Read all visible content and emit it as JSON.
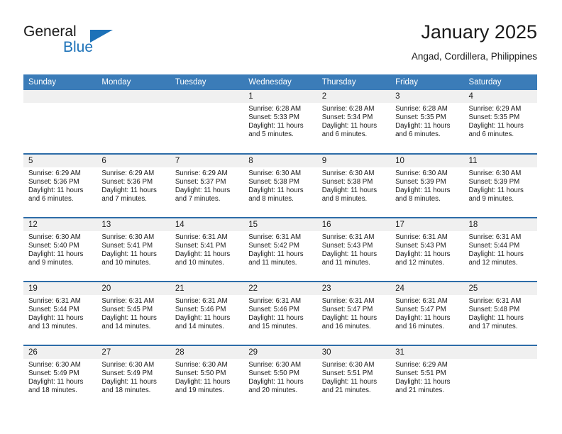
{
  "brand": {
    "name_part1": "General",
    "name_part2": "Blue",
    "triangle_color": "#1d72b8"
  },
  "header": {
    "title": "January 2025",
    "subtitle": "Angad, Cordillera, Philippines",
    "header_bg_color": "#3b7cb8",
    "separator_color": "#2d6ca8",
    "daynum_band_color": "#f0f0f0"
  },
  "weekday_headers": [
    "Sunday",
    "Monday",
    "Tuesday",
    "Wednesday",
    "Thursday",
    "Friday",
    "Saturday"
  ],
  "weeks": [
    [
      {
        "day": "",
        "sunrise": "",
        "sunset": "",
        "daylight1": "",
        "daylight2": ""
      },
      {
        "day": "",
        "sunrise": "",
        "sunset": "",
        "daylight1": "",
        "daylight2": ""
      },
      {
        "day": "",
        "sunrise": "",
        "sunset": "",
        "daylight1": "",
        "daylight2": ""
      },
      {
        "day": "1",
        "sunrise": "Sunrise: 6:28 AM",
        "sunset": "Sunset: 5:33 PM",
        "daylight1": "Daylight: 11 hours",
        "daylight2": "and 5 minutes."
      },
      {
        "day": "2",
        "sunrise": "Sunrise: 6:28 AM",
        "sunset": "Sunset: 5:34 PM",
        "daylight1": "Daylight: 11 hours",
        "daylight2": "and 6 minutes."
      },
      {
        "day": "3",
        "sunrise": "Sunrise: 6:28 AM",
        "sunset": "Sunset: 5:35 PM",
        "daylight1": "Daylight: 11 hours",
        "daylight2": "and 6 minutes."
      },
      {
        "day": "4",
        "sunrise": "Sunrise: 6:29 AM",
        "sunset": "Sunset: 5:35 PM",
        "daylight1": "Daylight: 11 hours",
        "daylight2": "and 6 minutes."
      }
    ],
    [
      {
        "day": "5",
        "sunrise": "Sunrise: 6:29 AM",
        "sunset": "Sunset: 5:36 PM",
        "daylight1": "Daylight: 11 hours",
        "daylight2": "and 6 minutes."
      },
      {
        "day": "6",
        "sunrise": "Sunrise: 6:29 AM",
        "sunset": "Sunset: 5:36 PM",
        "daylight1": "Daylight: 11 hours",
        "daylight2": "and 7 minutes."
      },
      {
        "day": "7",
        "sunrise": "Sunrise: 6:29 AM",
        "sunset": "Sunset: 5:37 PM",
        "daylight1": "Daylight: 11 hours",
        "daylight2": "and 7 minutes."
      },
      {
        "day": "8",
        "sunrise": "Sunrise: 6:30 AM",
        "sunset": "Sunset: 5:38 PM",
        "daylight1": "Daylight: 11 hours",
        "daylight2": "and 8 minutes."
      },
      {
        "day": "9",
        "sunrise": "Sunrise: 6:30 AM",
        "sunset": "Sunset: 5:38 PM",
        "daylight1": "Daylight: 11 hours",
        "daylight2": "and 8 minutes."
      },
      {
        "day": "10",
        "sunrise": "Sunrise: 6:30 AM",
        "sunset": "Sunset: 5:39 PM",
        "daylight1": "Daylight: 11 hours",
        "daylight2": "and 8 minutes."
      },
      {
        "day": "11",
        "sunrise": "Sunrise: 6:30 AM",
        "sunset": "Sunset: 5:39 PM",
        "daylight1": "Daylight: 11 hours",
        "daylight2": "and 9 minutes."
      }
    ],
    [
      {
        "day": "12",
        "sunrise": "Sunrise: 6:30 AM",
        "sunset": "Sunset: 5:40 PM",
        "daylight1": "Daylight: 11 hours",
        "daylight2": "and 9 minutes."
      },
      {
        "day": "13",
        "sunrise": "Sunrise: 6:30 AM",
        "sunset": "Sunset: 5:41 PM",
        "daylight1": "Daylight: 11 hours",
        "daylight2": "and 10 minutes."
      },
      {
        "day": "14",
        "sunrise": "Sunrise: 6:31 AM",
        "sunset": "Sunset: 5:41 PM",
        "daylight1": "Daylight: 11 hours",
        "daylight2": "and 10 minutes."
      },
      {
        "day": "15",
        "sunrise": "Sunrise: 6:31 AM",
        "sunset": "Sunset: 5:42 PM",
        "daylight1": "Daylight: 11 hours",
        "daylight2": "and 11 minutes."
      },
      {
        "day": "16",
        "sunrise": "Sunrise: 6:31 AM",
        "sunset": "Sunset: 5:43 PM",
        "daylight1": "Daylight: 11 hours",
        "daylight2": "and 11 minutes."
      },
      {
        "day": "17",
        "sunrise": "Sunrise: 6:31 AM",
        "sunset": "Sunset: 5:43 PM",
        "daylight1": "Daylight: 11 hours",
        "daylight2": "and 12 minutes."
      },
      {
        "day": "18",
        "sunrise": "Sunrise: 6:31 AM",
        "sunset": "Sunset: 5:44 PM",
        "daylight1": "Daylight: 11 hours",
        "daylight2": "and 12 minutes."
      }
    ],
    [
      {
        "day": "19",
        "sunrise": "Sunrise: 6:31 AM",
        "sunset": "Sunset: 5:44 PM",
        "daylight1": "Daylight: 11 hours",
        "daylight2": "and 13 minutes."
      },
      {
        "day": "20",
        "sunrise": "Sunrise: 6:31 AM",
        "sunset": "Sunset: 5:45 PM",
        "daylight1": "Daylight: 11 hours",
        "daylight2": "and 14 minutes."
      },
      {
        "day": "21",
        "sunrise": "Sunrise: 6:31 AM",
        "sunset": "Sunset: 5:46 PM",
        "daylight1": "Daylight: 11 hours",
        "daylight2": "and 14 minutes."
      },
      {
        "day": "22",
        "sunrise": "Sunrise: 6:31 AM",
        "sunset": "Sunset: 5:46 PM",
        "daylight1": "Daylight: 11 hours",
        "daylight2": "and 15 minutes."
      },
      {
        "day": "23",
        "sunrise": "Sunrise: 6:31 AM",
        "sunset": "Sunset: 5:47 PM",
        "daylight1": "Daylight: 11 hours",
        "daylight2": "and 16 minutes."
      },
      {
        "day": "24",
        "sunrise": "Sunrise: 6:31 AM",
        "sunset": "Sunset: 5:47 PM",
        "daylight1": "Daylight: 11 hours",
        "daylight2": "and 16 minutes."
      },
      {
        "day": "25",
        "sunrise": "Sunrise: 6:31 AM",
        "sunset": "Sunset: 5:48 PM",
        "daylight1": "Daylight: 11 hours",
        "daylight2": "and 17 minutes."
      }
    ],
    [
      {
        "day": "26",
        "sunrise": "Sunrise: 6:30 AM",
        "sunset": "Sunset: 5:49 PM",
        "daylight1": "Daylight: 11 hours",
        "daylight2": "and 18 minutes."
      },
      {
        "day": "27",
        "sunrise": "Sunrise: 6:30 AM",
        "sunset": "Sunset: 5:49 PM",
        "daylight1": "Daylight: 11 hours",
        "daylight2": "and 18 minutes."
      },
      {
        "day": "28",
        "sunrise": "Sunrise: 6:30 AM",
        "sunset": "Sunset: 5:50 PM",
        "daylight1": "Daylight: 11 hours",
        "daylight2": "and 19 minutes."
      },
      {
        "day": "29",
        "sunrise": "Sunrise: 6:30 AM",
        "sunset": "Sunset: 5:50 PM",
        "daylight1": "Daylight: 11 hours",
        "daylight2": "and 20 minutes."
      },
      {
        "day": "30",
        "sunrise": "Sunrise: 6:30 AM",
        "sunset": "Sunset: 5:51 PM",
        "daylight1": "Daylight: 11 hours",
        "daylight2": "and 21 minutes."
      },
      {
        "day": "31",
        "sunrise": "Sunrise: 6:29 AM",
        "sunset": "Sunset: 5:51 PM",
        "daylight1": "Daylight: 11 hours",
        "daylight2": "and 21 minutes."
      },
      {
        "day": "",
        "sunrise": "",
        "sunset": "",
        "daylight1": "",
        "daylight2": ""
      }
    ]
  ]
}
